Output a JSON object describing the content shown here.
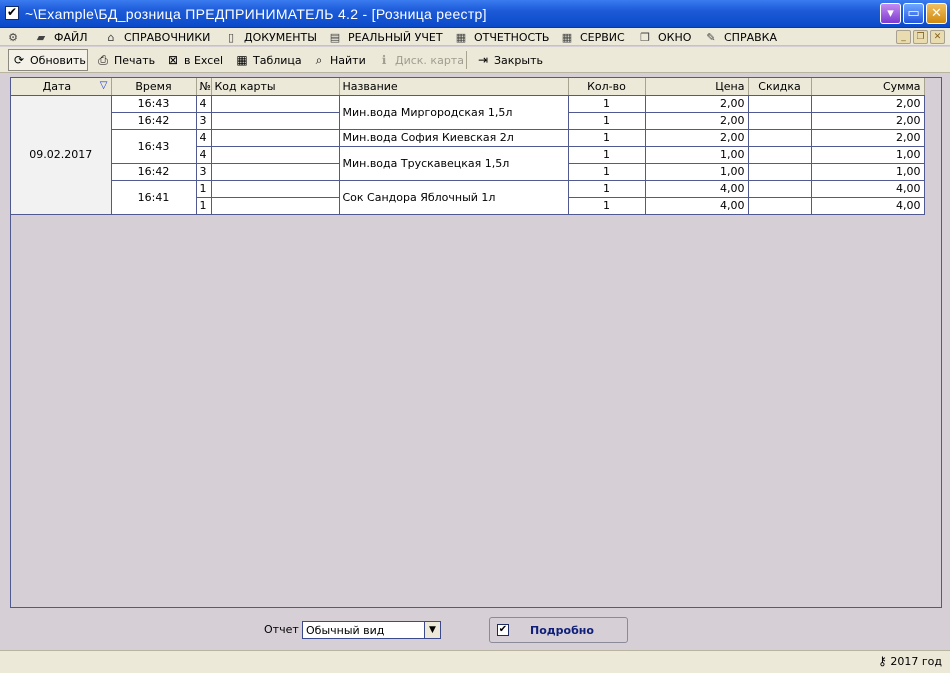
{
  "window": {
    "title": "~\\Example\\БД_розница  ПРЕДПРИНИМАТЕЛЬ 4.2 - [Розница реестр]"
  },
  "menu": [
    {
      "label": "ФАЙЛ",
      "icon": "folder-open-icon"
    },
    {
      "label": "СПРАВОЧНИКИ",
      "icon": "home-icon"
    },
    {
      "label": "ДОКУМЕНТЫ",
      "icon": "document-icon"
    },
    {
      "label": "РЕАЛЬНЫЙ УЧЕТ",
      "icon": "ledger-icon"
    },
    {
      "label": "ОТЧЕТНОСТЬ",
      "icon": "report-icon"
    },
    {
      "label": "СЕРВИС",
      "icon": "calculator-icon"
    },
    {
      "label": "ОКНО",
      "icon": "window-icon"
    },
    {
      "label": "СПРАВКА",
      "icon": "book-icon"
    }
  ],
  "toolbar": {
    "refresh": "Обновить",
    "print": "Печать",
    "excel": "в Excel",
    "table": "Таблица",
    "find": "Найти",
    "disc_card": "Диск. карта",
    "close": "Закрыть"
  },
  "grid": {
    "columns": [
      "Дата",
      "Время",
      "№",
      "Код карты",
      "Название",
      "Кол-во",
      "Цена",
      "Скидка",
      "Сумма"
    ],
    "date": "09.02.2017",
    "rows": [
      {
        "time": "16:43",
        "num": "4",
        "card": "",
        "name": "Мин.вода Миргородская 1,5л",
        "qty": "1",
        "price": "2,00",
        "discount": "",
        "sum": "2,00"
      },
      {
        "time": "16:42",
        "num": "3",
        "card": "",
        "name": "",
        "qty": "1",
        "price": "2,00",
        "discount": "",
        "sum": "2,00"
      },
      {
        "time": "16:43",
        "num": "4",
        "card": "",
        "name": "Мин.вода София Киевская 2л",
        "qty": "1",
        "price": "2,00",
        "discount": "",
        "sum": "2,00"
      },
      {
        "time": "",
        "num": "4",
        "card": "",
        "name": "Мин.вода Трускавецкая 1,5л",
        "qty": "1",
        "price": "1,00",
        "discount": "",
        "sum": "1,00"
      },
      {
        "time": "16:42",
        "num": "3",
        "card": "",
        "name": "",
        "qty": "1",
        "price": "1,00",
        "discount": "",
        "sum": "1,00"
      },
      {
        "time": "16:41",
        "num": "1",
        "card": "",
        "name": "Сок Сандора Яблочный 1л",
        "qty": "1",
        "price": "4,00",
        "discount": "",
        "sum": "4,00"
      },
      {
        "time": "",
        "num": "1",
        "card": "",
        "name": "",
        "qty": "1",
        "price": "4,00",
        "discount": "",
        "sum": "4,00"
      }
    ]
  },
  "bottom": {
    "report_label": "Отчет",
    "report_value": "Обычный вид",
    "detail_label": "Подробно",
    "detail_checked": true
  },
  "status": {
    "year": "2017 год"
  }
}
